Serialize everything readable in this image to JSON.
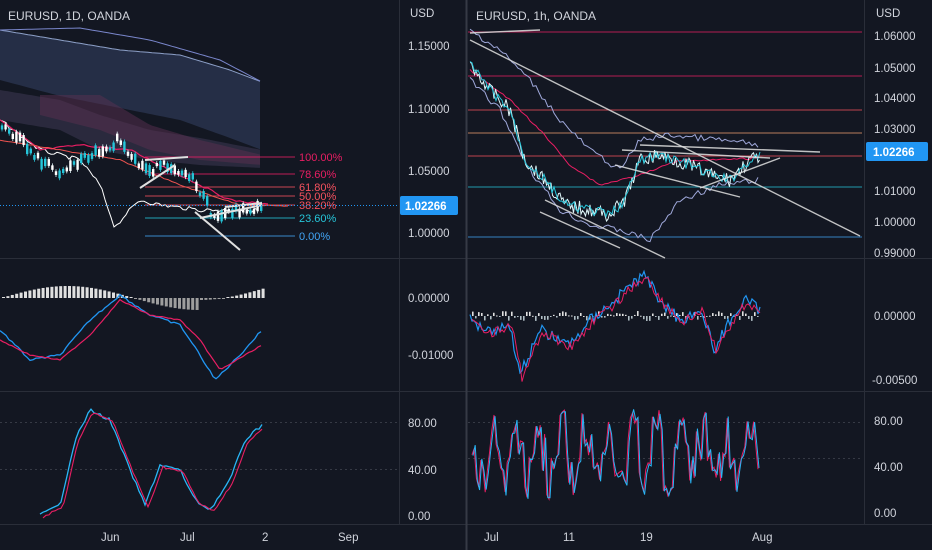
{
  "left_chart": {
    "title": "EURUSD, 1D, OANDA",
    "price_axis_label": "USD",
    "price_ticks": [
      "1.15000",
      "1.10000",
      "1.05000",
      "1.00000"
    ],
    "last_price": "1.02266",
    "fib_levels": [
      {
        "label": "100.00%",
        "color": "#e91e63"
      },
      {
        "label": "78.60%",
        "color": "#e91e63"
      },
      {
        "label": "61.80%",
        "color": "#f7525f"
      },
      {
        "label": "50.00%",
        "color": "#f7525f"
      },
      {
        "label": "38.20%",
        "color": "#f7525f"
      },
      {
        "label": "23.60%",
        "color": "#26c6da"
      },
      {
        "label": "0.00%",
        "color": "#42a5f5"
      }
    ],
    "macd_ticks": [
      "0.00000",
      "-0.01000"
    ],
    "stoch_ticks": [
      "80.00",
      "40.00",
      "0.00"
    ],
    "time_labels": [
      "Jun",
      "Jul",
      "2",
      "Sep"
    ]
  },
  "right_chart": {
    "title": "EURUSD, 1h, OANDA",
    "price_axis_label": "USD",
    "price_ticks": [
      "1.06000",
      "1.05000",
      "1.04000",
      "1.03000",
      "1.02000",
      "1.01000",
      "1.00000",
      "0.99000"
    ],
    "last_price": "1.02266",
    "macd_ticks": [
      "0.00000",
      "-0.00500"
    ],
    "stoch_ticks": [
      "80.00",
      "40.00",
      "0.00"
    ],
    "time_labels": [
      "Jul",
      "11",
      "19",
      "Aug"
    ]
  },
  "colors": {
    "background": "#131722",
    "grid": "#2a2e39",
    "price_badge": "#2196f3",
    "macd_line": "#2196f3",
    "signal_line": "#e91e63",
    "ichimoku_cloud": "#3a4a6b",
    "bollinger": "#9fa8da"
  }
}
